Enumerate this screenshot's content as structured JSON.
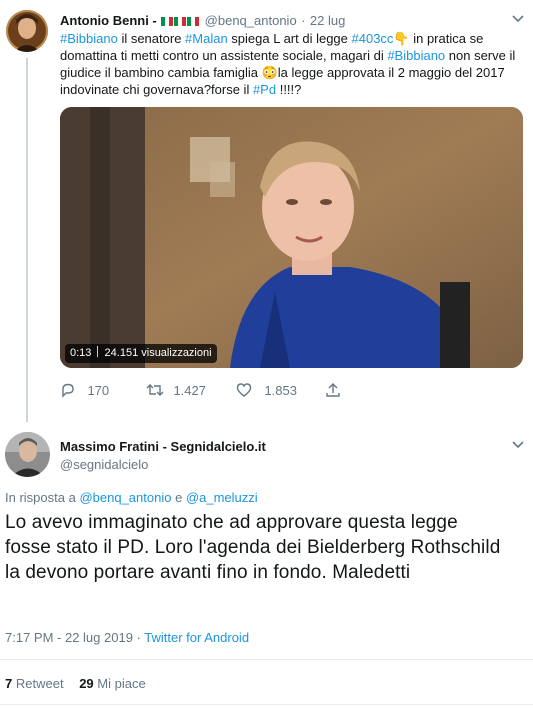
{
  "tweet": {
    "author_name": "Antonio Benni -",
    "handle": "@benq_antonio",
    "dot": "·",
    "date": "22 lug",
    "segments": [
      {
        "t": "#Bibbiano",
        "tag": true
      },
      {
        "t": " il senatore ",
        "tag": false
      },
      {
        "t": "#Malan",
        "tag": true
      },
      {
        "t": " spiega L art di legge ",
        "tag": false
      },
      {
        "t": "#403cc",
        "tag": true
      },
      {
        "t": "👇 in pratica se domattina ti metti contro un assistente sociale, magari di ",
        "tag": false
      },
      {
        "t": "#Bibbiano",
        "tag": true
      },
      {
        "t": " non serve il giudice il bambino cambia  famiglia 😳la legge approvata il 2 maggio del 2017 indovinate chi governava?forse il ",
        "tag": false
      },
      {
        "t": "#Pd",
        "tag": true
      },
      {
        "t": " !!!!?",
        "tag": false
      }
    ],
    "video": {
      "time": "0:13",
      "views": "24.151 visualizzazioni"
    },
    "actions": {
      "replies": "170",
      "retweets": "1.427",
      "likes": "1.853"
    }
  },
  "reply": {
    "author_name": "Massimo Fratini - Segnidalcielo.it",
    "handle": "@segnidalcielo",
    "in_reply_prefix": "In risposta a",
    "mention_1": "@benq_antonio",
    "and_word": "e",
    "mention_2": "@a_meluzzi",
    "text": "Lo avevo immaginato che ad approvare questa legge fosse stato il PD. Loro l'agenda dei Bielderberg Rothschild la devono portare avanti fino in fondo. Maledetti",
    "timestamp": "7:17 PM - 22 lug 2019",
    "dot": "·",
    "source": "Twitter for Android",
    "retweet_count": "7",
    "retweet_label": "Retweet",
    "like_count": "29",
    "like_label": "Mi piace"
  },
  "colors": {
    "link": "#1b95e0",
    "muted": "#657786",
    "text": "#14171a",
    "flag_green": "#009246",
    "flag_red": "#ce2b37"
  },
  "icons": [
    "chevron-down-icon",
    "reply-icon",
    "retweet-icon",
    "like-icon",
    "share-icon",
    "italy-flag-icon"
  ]
}
